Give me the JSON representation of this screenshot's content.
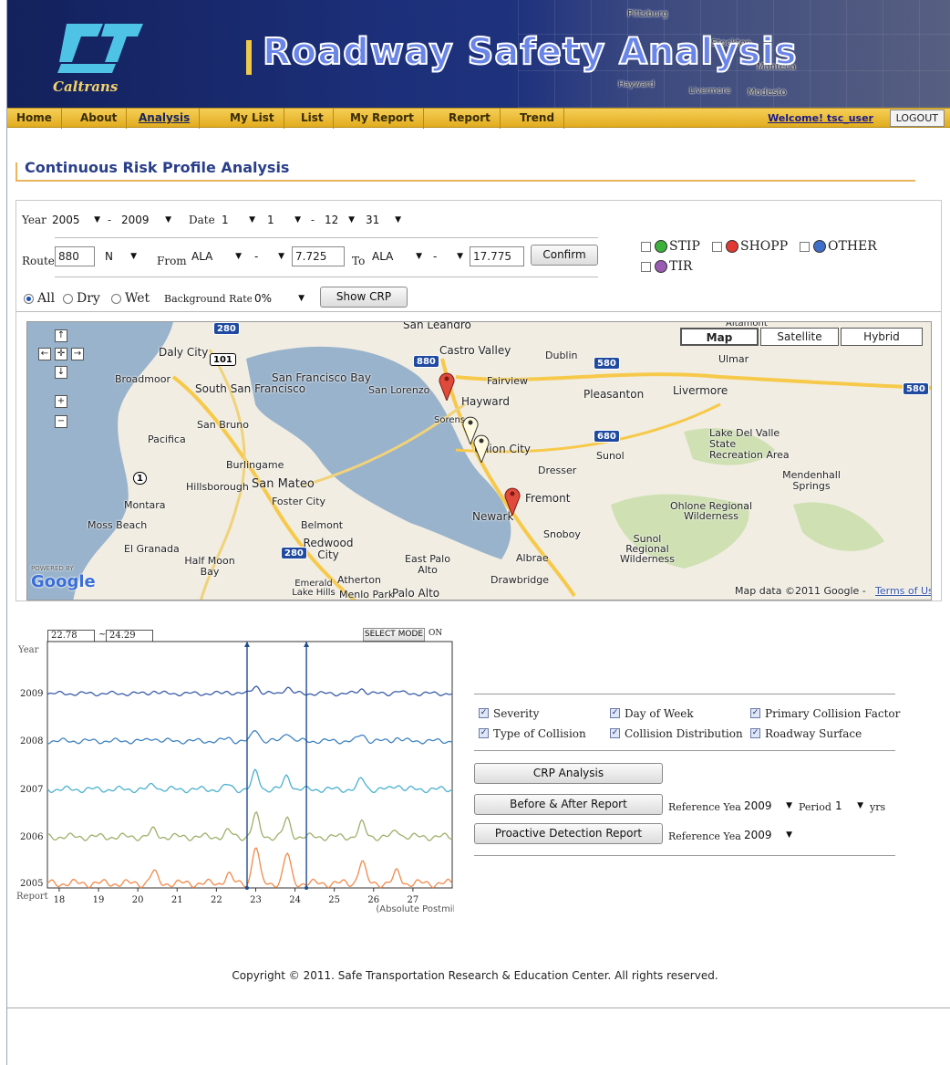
{
  "header": {
    "app_title": "Roadway Safety Analysis",
    "logo_text": "Caltrans",
    "map_place_names": [
      "Pittsburg",
      "Stockton",
      "Manteca",
      "Livermore",
      "Modesto",
      "Hayward",
      "Ripon"
    ]
  },
  "nav": {
    "items": [
      "Home",
      "About",
      "Analysis",
      "My List",
      "List",
      "My Report",
      "Report",
      "Trend"
    ],
    "active": "Analysis",
    "welcome": "Welcome!  tsc_user",
    "logout": "LOGOUT"
  },
  "page_title": "Continuous Risk Profile Analysis",
  "form": {
    "year_label": "Year",
    "year_from": "2005",
    "year_to": "2009",
    "dash": "-",
    "date_label": "Date",
    "date_from_month": "1",
    "date_from_day": "1",
    "date_to_month": "12",
    "date_to_day": "31",
    "route_label": "Route",
    "route": "880",
    "direction": "N",
    "from_label": "From",
    "from_county": "ALA",
    "from_prefix": "-",
    "from_postmile": "7.725",
    "to_label": "To",
    "to_county": "ALA",
    "to_prefix": "-",
    "to_postmile": "17.775",
    "confirm_button": "Confirm",
    "project_filters": [
      "STIP",
      "SHOPP",
      "OTHER",
      "TIR"
    ],
    "surface_options": [
      "All",
      "Dry",
      "Wet"
    ],
    "surface_selected": "All",
    "background_rate_label": "Background Rate",
    "background_rate": "0%",
    "show_crp_button": "Show CRP"
  },
  "map": {
    "map_types": [
      "Map",
      "Satellite",
      "Hybrid"
    ],
    "selected_type": "Map",
    "attribution": "Map data ©2011 Google -",
    "terms_link": "Terms of Use",
    "powered_by": "POWERED BY",
    "google": "Google",
    "labels": [
      "San Leandro",
      "Daly City",
      "Castro Valley",
      "Dublin",
      "Ulmar",
      "Broadmoor",
      "San Francisco Bay",
      "San Lorenzo",
      "Fairview",
      "South San Francisco",
      "Hayward",
      "Pleasanton",
      "Livermore",
      "San Bruno",
      "Lake Del Valle State Recreation Area",
      "Pacifica",
      "Union City",
      "Sunol",
      "Dresser",
      "Burlingame",
      "Hillsborough",
      "San Mateo",
      "Mendenhall Springs",
      "Foster City",
      "Fremont",
      "Montara",
      "Newark",
      "Ohlone Regional Wilderness",
      "Moss Beach",
      "Belmont",
      "Snoboy",
      "El Granada",
      "Redwood City",
      "Sunol Regional Wilderness",
      "Half Moon Bay",
      "East Palo Alto",
      "Albrae",
      "Emerald Lake Hills",
      "Atherton",
      "Menlo Park",
      "Palo Alto",
      "Drawbridge",
      "Sorens",
      "Altamont"
    ],
    "shields": [
      "280",
      "101",
      "880",
      "580",
      "580",
      "680",
      "1",
      "280"
    ]
  },
  "chart": {
    "range_from": "22.78",
    "range_sep": "~",
    "range_to": "24.29",
    "select_mode_button": "SELECT MODE",
    "select_mode_state": "ON",
    "y_title": "Year",
    "y_bottom_label": "Report",
    "x_caption": "(Absolute Postmile)"
  },
  "chart_data": {
    "type": "line",
    "x": [
      18,
      19,
      20,
      21,
      22,
      23,
      24,
      25,
      26,
      27
    ],
    "x_range": [
      17.7,
      28.0
    ],
    "years": [
      "2005",
      "2006",
      "2007",
      "2008",
      "2009"
    ],
    "series": [
      {
        "name": "2005",
        "color": "#f08a4b"
      },
      {
        "name": "2006",
        "color": "#9db06a"
      },
      {
        "name": "2007",
        "color": "#4ab0cf"
      },
      {
        "name": "2008",
        "color": "#3f83c2"
      },
      {
        "name": "2009",
        "color": "#3a5ca8"
      }
    ],
    "selection": [
      22.78,
      24.29
    ]
  },
  "options": {
    "checkboxes": [
      {
        "label": "Severity",
        "checked": true
      },
      {
        "label": "Day of Week",
        "checked": true
      },
      {
        "label": "Primary Collision Factor",
        "checked": true
      },
      {
        "label": "Type of Collision",
        "checked": true
      },
      {
        "label": "Collision Distribution",
        "checked": true
      },
      {
        "label": "Roadway Surface",
        "checked": true
      }
    ],
    "crp_analysis_button": "CRP Analysis",
    "before_after_button": "Before & After Report",
    "proactive_button": "Proactive Detection Report",
    "reference_year_label": "Reference Year",
    "reference_year": "2009",
    "period_label": "Period",
    "period": "1",
    "yrs_label": "yrs",
    "proactive_reference_year": "2009"
  },
  "footer": "Copyright © 2011.  Safe Transportation Research & Education Center.  All rights reserved."
}
